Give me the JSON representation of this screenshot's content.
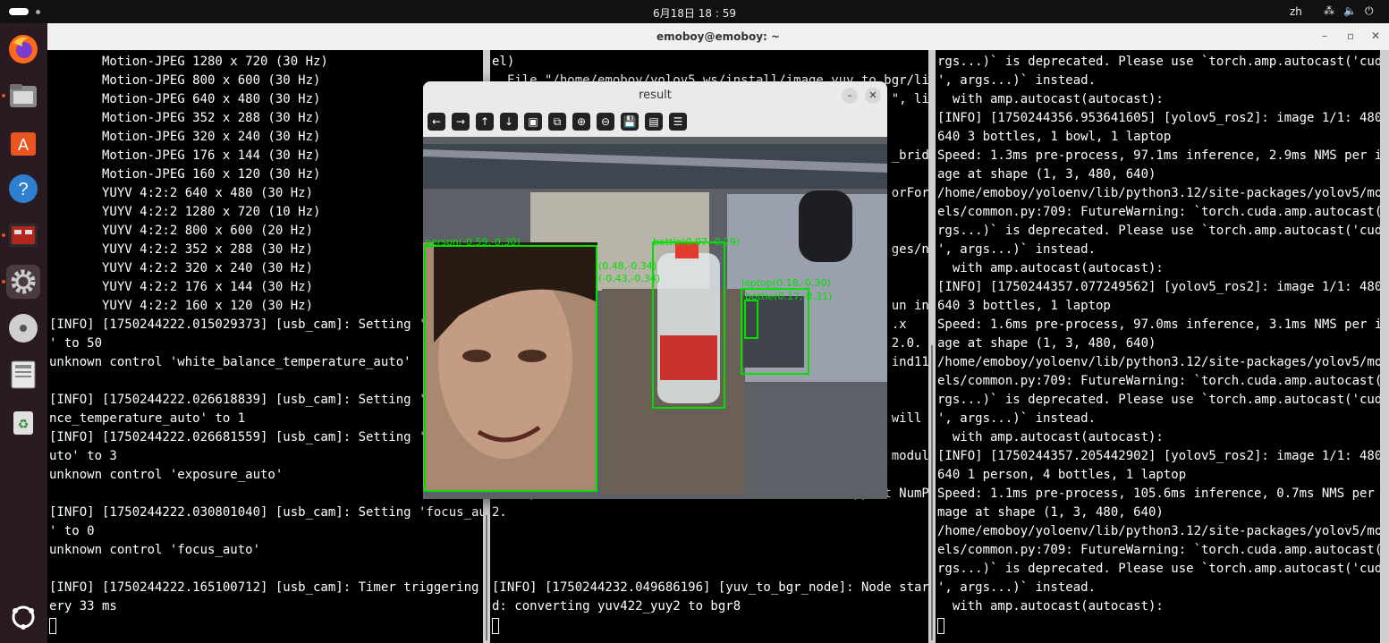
{
  "topbar": {
    "clock": "6月18日 18 : 59",
    "language": "zh"
  },
  "dock": {
    "items": [
      "firefox-icon",
      "files-icon",
      "app-center-icon",
      "help-icon",
      "system-monitor-icon",
      "settings-icon",
      "disc-icon",
      "save-icon",
      "trash-icon",
      "show-apps-icon"
    ]
  },
  "terminal": {
    "title": "emoboy@emoboy: ~"
  },
  "panes": {
    "left": [
      "       Motion-JPEG 1280 x 720 (30 Hz)",
      "       Motion-JPEG 800 x 600 (30 Hz)",
      "       Motion-JPEG 640 x 480 (30 Hz)",
      "       Motion-JPEG 352 x 288 (30 Hz)",
      "       Motion-JPEG 320 x 240 (30 Hz)",
      "       Motion-JPEG 176 x 144 (30 Hz)",
      "       Motion-JPEG 160 x 120 (30 Hz)",
      "       YUYV 4:2:2 640 x 480 (30 Hz)",
      "       YUYV 4:2:2 1280 x 720 (10 Hz)",
      "       YUYV 4:2:2 800 x 600 (20 Hz)",
      "       YUYV 4:2:2 352 x 288 (30 Hz)",
      "       YUYV 4:2:2 320 x 240 (30 Hz)",
      "       YUYV 4:2:2 176 x 144 (30 Hz)",
      "       YUYV 4:2:2 160 x 120 (30 Hz)",
      "[INFO] [1750244222.015029373] [usb_cam]: Setting 'bri",
      "' to 50",
      "unknown control 'white_balance_temperature_auto'",
      "",
      "[INFO] [1750244222.026618839] [usb_cam]: Setting 'whi",
      "nce_temperature_auto' to 1",
      "[INFO] [1750244222.026681559] [usb_cam]: Setting 'exp",
      "uto' to 3",
      "unknown control 'exposure_auto'",
      "",
      "[INFO] [1750244222.030801040] [usb_cam]: Setting 'focus_auto",
      "' to 0",
      "unknown control 'focus_auto'",
      "",
      "[INFO] [1750244222.165100712] [usb_cam]: Timer triggering ev",
      "ery 33 ms"
    ],
    "middle": [
      "el)",
      "  File \"/home/emoboy/yolov5_ws/install/image_yuv_to_bgr/lib/",
      "                                                     \", lin",
      "",
      "",
      "                                                     _bridg",
      "",
      "                                                     orForD",
      "",
      "",
      "                                                     ges/nu",
      "",
      "",
      "                                                     un in",
      "                                                     .x",
      "                                                     2.0.",
      "                                                     ind11>",
      "",
      "",
      "                                                     will b",
      "",
      "                                                     module",
      "",
      "We expect that some modules will need time to support NumPy",
      "2.",
      "",
      "",
      "",
      "[INFO] [1750244232.049686196] [yuv_to_bgr_node]: Node starte",
      "d: converting yuv422_yuy2 to bgr8"
    ],
    "right": [
      "rgs...)` is deprecated. Please use `torch.amp.autocast('cuda",
      "', args...)` instead.",
      "  with amp.autocast(autocast):",
      "[INFO] [1750244356.953641605] [yolov5_ros2]: image 1/1: 480x",
      "640 3 bottles, 1 bowl, 1 laptop",
      "Speed: 1.3ms pre-process, 97.1ms inference, 2.9ms NMS per im",
      "age at shape (1, 3, 480, 640)",
      "/home/emoboy/yoloenv/lib/python3.12/site-packages/yolov5/mod",
      "els/common.py:709: FutureWarning: `torch.cuda.amp.autocast(a",
      "rgs...)` is deprecated. Please use `torch.amp.autocast('cuda",
      "', args...)` instead.",
      "  with amp.autocast(autocast):",
      "[INFO] [1750244357.077249562] [yolov5_ros2]: image 1/1: 480x",
      "640 3 bottles, 1 laptop",
      "Speed: 1.6ms pre-process, 97.0ms inference, 3.1ms NMS per im",
      "age at shape (1, 3, 480, 640)",
      "/home/emoboy/yoloenv/lib/python3.12/site-packages/yolov5/mod",
      "els/common.py:709: FutureWarning: `torch.cuda.amp.autocast(a",
      "rgs...)` is deprecated. Please use `torch.amp.autocast('cuda",
      "', args...)` instead.",
      "  with amp.autocast(autocast):",
      "[INFO] [1750244357.205442902] [yolov5_ros2]: image 1/1: 480x",
      "640 1 person, 4 bottles, 1 laptop",
      "Speed: 1.1ms pre-process, 105.6ms inference, 0.7ms NMS per i",
      "mage at shape (1, 3, 480, 640)",
      "/home/emoboy/yoloenv/lib/python3.12/site-packages/yolov5/mod",
      "els/common.py:709: FutureWarning: `torch.cuda.amp.autocast(a",
      "rgs...)` is deprecated. Please use `torch.amp.autocast('cuda",
      "', args...)` instead.",
      "  with amp.autocast(autocast):"
    ]
  },
  "result_window": {
    "title": "result",
    "toolbar": [
      {
        "name": "pan-left",
        "glyph": "←"
      },
      {
        "name": "pan-right",
        "glyph": "→"
      },
      {
        "name": "pan-up",
        "glyph": "↑"
      },
      {
        "name": "pan-down",
        "glyph": "↓"
      },
      {
        "name": "zoom-fit",
        "glyph": "▣"
      },
      {
        "name": "zoom-original",
        "glyph": "⧉"
      },
      {
        "name": "zoom-in",
        "glyph": "⊕"
      },
      {
        "name": "zoom-out",
        "glyph": "⊖"
      },
      {
        "name": "save",
        "glyph": "💾"
      },
      {
        "name": "copy",
        "glyph": "▤"
      },
      {
        "name": "properties",
        "glyph": "☰"
      }
    ],
    "detections": [
      {
        "label": "person(-0.59,-0.30)",
        "color": "#00e000"
      },
      {
        "label": "bottle(0.07,-0.29)",
        "color": "#00e000"
      },
      {
        "label": "(0.48,-0.34)",
        "color": "#00e000"
      },
      {
        "label": "(-0.43,-0.34)",
        "color": "#00e000"
      },
      {
        "label": "laptop(0.18,-0.30)",
        "color": "#00e000"
      },
      {
        "label": "bottle(0.17,-0.31)",
        "color": "#00e000"
      }
    ]
  }
}
